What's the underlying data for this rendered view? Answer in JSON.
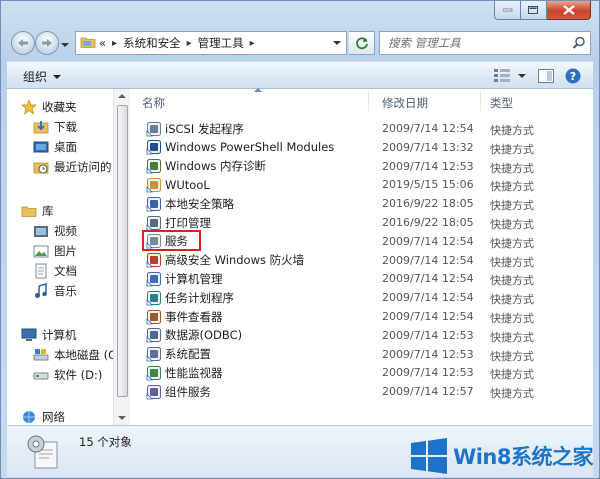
{
  "window": {
    "caption_buttons": [
      "minimize",
      "maximize",
      "close"
    ]
  },
  "nav": {
    "breadcrumb_prefix": "«",
    "breadcrumb": [
      "系统和安全",
      "管理工具"
    ],
    "search_placeholder": "搜索 管理工具"
  },
  "toolbar": {
    "organize_label": "组织"
  },
  "sidebar": {
    "favorites": "收藏夹",
    "favorites_items": [
      "下载",
      "桌面",
      "最近访问的"
    ],
    "libraries": "库",
    "libraries_items": [
      "视频",
      "图片",
      "文档",
      "音乐"
    ],
    "computer": "计算机",
    "computer_items": [
      "本地磁盘 (C",
      "软件 (D:)"
    ],
    "network": "网络"
  },
  "columns": {
    "name": "名称",
    "modified": "修改日期",
    "type": "类型"
  },
  "files": [
    {
      "name": "iSCSI 发起程序",
      "date": "2009/7/14 12:54",
      "type": "快捷方式",
      "icon": "iscsi-icon"
    },
    {
      "name": "Windows PowerShell Modules",
      "date": "2009/7/14 13:32",
      "type": "快捷方式",
      "icon": "powershell-icon"
    },
    {
      "name": "Windows 内存诊断",
      "date": "2009/7/14 12:53",
      "type": "快捷方式",
      "icon": "memory-diagnostic-icon"
    },
    {
      "name": "WUtooL",
      "date": "2019/5/15 15:06",
      "type": "快捷方式",
      "icon": "wutool-icon"
    },
    {
      "name": "本地安全策略",
      "date": "2016/9/22 18:05",
      "type": "快捷方式",
      "icon": "local-security-policy-icon"
    },
    {
      "name": "打印管理",
      "date": "2016/9/22 18:05",
      "type": "快捷方式",
      "icon": "print-management-icon"
    },
    {
      "name": "服务",
      "date": "2009/7/14 12:54",
      "type": "快捷方式",
      "icon": "services-icon"
    },
    {
      "name": "高级安全 Windows 防火墙",
      "date": "2009/7/14 12:54",
      "type": "快捷方式",
      "icon": "firewall-icon"
    },
    {
      "name": "计算机管理",
      "date": "2009/7/14 12:54",
      "type": "快捷方式",
      "icon": "computer-management-icon"
    },
    {
      "name": "任务计划程序",
      "date": "2009/7/14 12:54",
      "type": "快捷方式",
      "icon": "task-scheduler-icon"
    },
    {
      "name": "事件查看器",
      "date": "2009/7/14 12:54",
      "type": "快捷方式",
      "icon": "event-viewer-icon"
    },
    {
      "name": "数据源(ODBC)",
      "date": "2009/7/14 12:53",
      "type": "快捷方式",
      "icon": "odbc-icon"
    },
    {
      "name": "系统配置",
      "date": "2009/7/14 12:53",
      "type": "快捷方式",
      "icon": "system-configuration-icon"
    },
    {
      "name": "性能监视器",
      "date": "2009/7/14 12:53",
      "type": "快捷方式",
      "icon": "performance-monitor-icon"
    },
    {
      "name": "组件服务",
      "date": "2009/7/14 12:57",
      "type": "快捷方式",
      "icon": "component-services-icon"
    }
  ],
  "status": {
    "count_text": "15 个对象"
  },
  "watermark": {
    "text": "Win8系统之家"
  },
  "colors": {
    "highlight_border": "#e02020",
    "watermark_blue": "#1d73c9"
  }
}
